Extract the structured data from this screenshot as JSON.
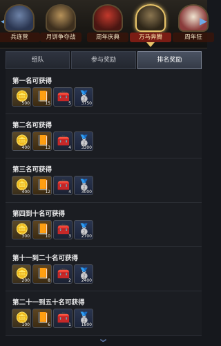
{
  "events": [
    {
      "label": "兵连营",
      "selected": false
    },
    {
      "label": "月饼争夺战",
      "selected": false
    },
    {
      "label": "周年庆典",
      "selected": false
    },
    {
      "label": "万马奔腾",
      "selected": true
    },
    {
      "label": "周年狂",
      "selected": false
    }
  ],
  "tabs": [
    {
      "label": "组队",
      "active": false
    },
    {
      "label": "参与奖励",
      "active": false
    },
    {
      "label": "排名奖励",
      "active": true
    }
  ],
  "reward_groups": [
    {
      "title": "第一名可获得",
      "counts": [
        "500",
        "15",
        "5",
        "3750"
      ]
    },
    {
      "title": "第二名可获得",
      "counts": [
        "400",
        "13",
        "4",
        "3300"
      ]
    },
    {
      "title": "第三名可获得",
      "counts": [
        "400",
        "12",
        "4",
        "3000"
      ]
    },
    {
      "title": "第四到十名可获得",
      "counts": [
        "300",
        "10",
        "3",
        "2700"
      ]
    },
    {
      "title": "第十一到二十名可获得",
      "counts": [
        "200",
        "8",
        "2",
        "2400"
      ]
    },
    {
      "title": "第二十一到五十名可获得",
      "counts": [
        "100",
        "6",
        "1",
        "1800"
      ]
    }
  ],
  "item_icons": [
    "gold-ingot-icon",
    "book-icon",
    "treasure-chest-icon",
    "silver-coin-icon"
  ],
  "accent": "#e8c46a"
}
